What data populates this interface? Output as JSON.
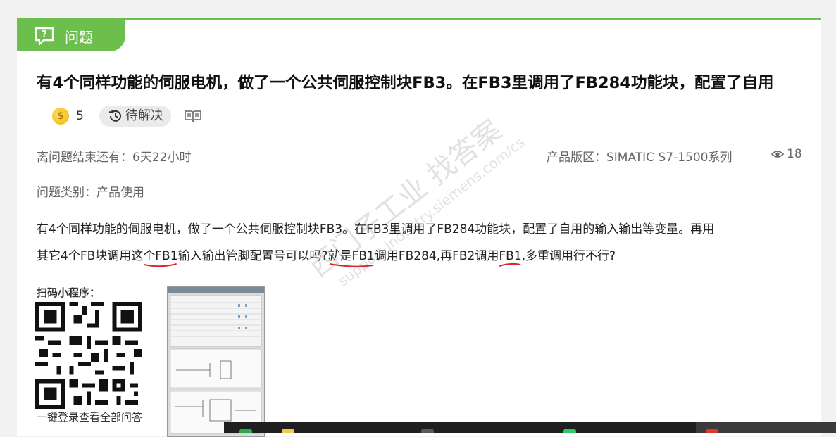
{
  "tag": {
    "label": "问题",
    "icon": "question-bubble-icon"
  },
  "question": {
    "title": "有4个同样功能的伺服电机，做了一个公共伺服控制块FB3。在FB3里调用了FB284功能块，配置了自用",
    "coins": "5",
    "status": "待解决"
  },
  "meta": {
    "remaining_time": "离问题结束还有：6天22小时",
    "product_area": "产品版区：SIMATIC S7-1500系列",
    "views": "18",
    "category": "问题类别：产品使用"
  },
  "body": {
    "line1": "有4个同样功能的伺服电机，做了一个公共伺服控制块FB3。在FB3里调用了FB284功能块，配置了自用的输入输出等变量。再用",
    "line2_a": "其它4个FB块调用这",
    "line2_b": "个FB1",
    "line2_c": "输入输出管脚配置号可以吗?",
    "line2_d": "就是FB1",
    "line2_e": "调用FB284,再FB2调用",
    "line2_f": "FB1",
    "line2_g": ",多重调用行不行?"
  },
  "qr": {
    "label": "扫码小程序：",
    "caption": "一键登录查看全部问答"
  },
  "watermark": {
    "main": "西门子工业  找答案",
    "url": "support.industry.siemens.com/cs"
  },
  "colors": {
    "accent": "#6cbf4c",
    "underline": "#d9262b"
  }
}
